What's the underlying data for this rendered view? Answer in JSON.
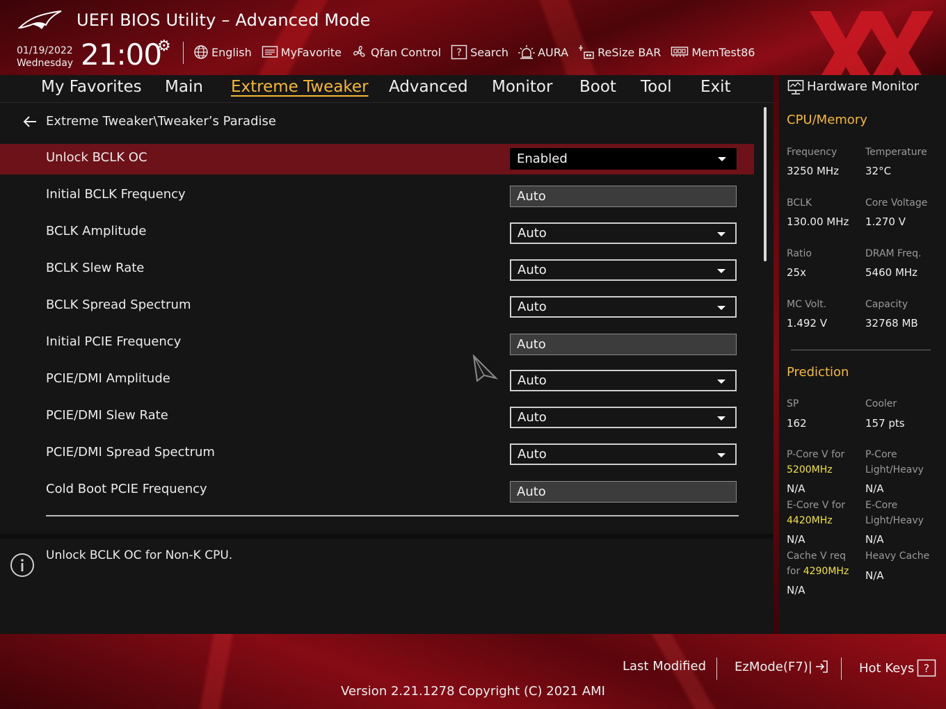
{
  "header": {
    "title": "UEFI BIOS Utility – Advanced Mode",
    "date": "01/19/2022",
    "weekday": "Wednesday",
    "time": "21:00",
    "toolbar": {
      "english": "English",
      "myfavorite": "MyFavorite",
      "qfan": "Qfan Control",
      "search": "Search",
      "aura": "AURA",
      "resizebar": "ReSize BAR",
      "memtest": "MemTest86"
    }
  },
  "nav": {
    "tabs": [
      {
        "label": "My Favorites"
      },
      {
        "label": "Main"
      },
      {
        "label": "Extreme Tweaker"
      },
      {
        "label": "Advanced"
      },
      {
        "label": "Monitor"
      },
      {
        "label": "Boot"
      },
      {
        "label": "Tool"
      },
      {
        "label": "Exit"
      }
    ],
    "active": "Extreme Tweaker"
  },
  "breadcrumb": "Extreme Tweaker\\Tweaker’s Paradise",
  "settings": [
    {
      "label": "Unlock BCLK OC",
      "value": "Enabled"
    },
    {
      "label": "Initial BCLK Frequency",
      "value": "Auto"
    },
    {
      "label": "BCLK Amplitude",
      "value": "Auto"
    },
    {
      "label": "BCLK Slew Rate",
      "value": "Auto"
    },
    {
      "label": "BCLK Spread Spectrum",
      "value": "Auto"
    },
    {
      "label": "Initial PCIE Frequency",
      "value": "Auto"
    },
    {
      "label": "PCIE/DMI Amplitude",
      "value": "Auto"
    },
    {
      "label": "PCIE/DMI Slew Rate",
      "value": "Auto"
    },
    {
      "label": "PCIE/DMI Spread Spectrum",
      "value": "Auto"
    },
    {
      "label": "Cold Boot PCIE Frequency",
      "value": "Auto"
    }
  ],
  "help": {
    "text": "Unlock BCLK OC for Non-K CPU."
  },
  "hw": {
    "title": "Hardware Monitor",
    "cpu_section": "CPU/Memory",
    "frequency_label": "Frequency",
    "frequency": "3250 MHz",
    "temperature_label": "Temperature",
    "temperature": "32°C",
    "bclk_label": "BCLK",
    "bclk": "130.00 MHz",
    "core_voltage_label": "Core Voltage",
    "core_voltage": "1.270 V",
    "ratio_label": "Ratio",
    "ratio": "25x",
    "dram_label": "DRAM Freq.",
    "dram": "5460 MHz",
    "mc_label": "MC Volt.",
    "mc": "1.492 V",
    "capacity_label": "Capacity",
    "capacity": "32768 MB",
    "prediction_section": "Prediction",
    "sp_label": "SP",
    "sp": "162",
    "cooler_label": "Cooler",
    "cooler": "157 pts",
    "pcore_v_label1": "P-Core V for",
    "pcore_v_freq": "5200MHz",
    "pcore_v": "N/A",
    "pcore_lh_label1": "P-Core",
    "pcore_lh_label2": "Light/Heavy",
    "pcore_lh": "N/A",
    "ecore_v_label1": "E-Core V for",
    "ecore_v_freq": "4420MHz",
    "ecore_v": "N/A",
    "ecore_lh_label1": "E-Core",
    "ecore_lh_label2": "Light/Heavy",
    "ecore_lh": "N/A",
    "cache_v_label1": "Cache V req",
    "cache_v_label2": "for",
    "cache_v_freq": "4290MHz",
    "cache_v": "N/A",
    "heavy_cache_label": "Heavy Cache",
    "heavy_cache": "N/A"
  },
  "footer": {
    "last_modified": "Last Modified",
    "ezmode": "EzMode(F7)|",
    "hotkeys": "Hot Keys",
    "version": "Version 2.21.1278 Copyright (C) 2021 AMI"
  },
  "colors": {
    "accent": "#f6b935",
    "highlight_row": "#6e1219",
    "prediction_freq": "#f3e33a"
  }
}
